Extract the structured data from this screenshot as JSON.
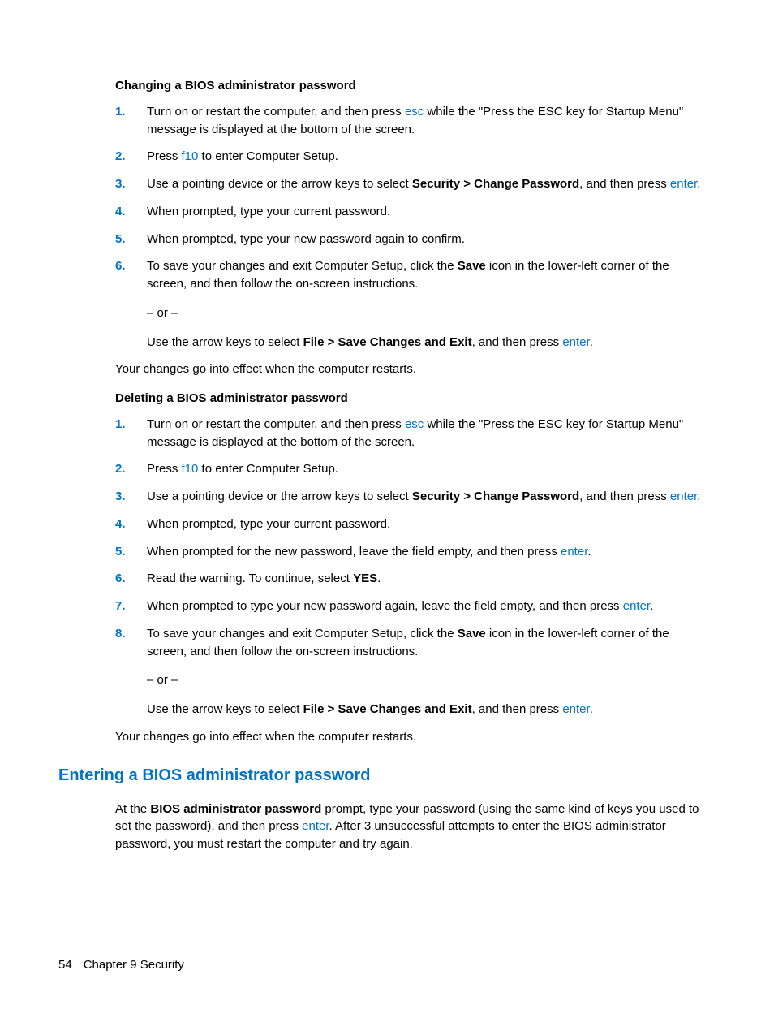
{
  "section1": {
    "heading": "Changing a BIOS administrator password",
    "step1a": "Turn on or restart the computer, and then press ",
    "step1k": "esc",
    "step1b": " while the \"Press the ESC key for Startup Menu\" message is displayed at the bottom of the screen.",
    "step2a": "Press ",
    "step2k": "f10",
    "step2b": " to enter Computer Setup.",
    "step3a": "Use a pointing device or the arrow keys to select ",
    "step3b": "Security > Change Password",
    "step3c": ", and then press ",
    "step3k": "enter",
    "step3d": ".",
    "step4": "When prompted, type your current password.",
    "step5": "When prompted, type your new password again to confirm.",
    "step6a": "To save your changes and exit Computer Setup, click the ",
    "step6b": "Save",
    "step6c": " icon in the lower-left corner of the screen, and then follow the on-screen instructions.",
    "or": "– or –",
    "alt_a": "Use the arrow keys to select ",
    "alt_b": "File > Save Changes and Exit",
    "alt_c": ", and then press ",
    "alt_k": "enter",
    "alt_d": ".",
    "after": "Your changes go into effect when the computer restarts."
  },
  "section2": {
    "heading": "Deleting a BIOS administrator password",
    "step1a": "Turn on or restart the computer, and then press ",
    "step1k": "esc",
    "step1b": " while the \"Press the ESC key for Startup Menu\" message is displayed at the bottom of the screen.",
    "step2a": "Press ",
    "step2k": "f10",
    "step2b": " to enter Computer Setup.",
    "step3a": "Use a pointing device or the arrow keys to select ",
    "step3b": "Security > Change Password",
    "step3c": ", and then press ",
    "step3k": "enter",
    "step3d": ".",
    "step4": "When prompted, type your current password.",
    "step5a": "When prompted for the new password, leave the field empty, and then press ",
    "step5k": "enter",
    "step5b": ".",
    "step6a": "Read the warning. To continue, select ",
    "step6b": "YES",
    "step6c": ".",
    "step7a": "When prompted to type your new password again, leave the field empty, and then press ",
    "step7k": "enter",
    "step7b": ".",
    "step8a": "To save your changes and exit Computer Setup, click the ",
    "step8b": "Save",
    "step8c": " icon in the lower-left corner of the screen, and then follow the on-screen instructions.",
    "or": "– or –",
    "alt_a": "Use the arrow keys to select ",
    "alt_b": "File > Save Changes and Exit",
    "alt_c": ", and then press ",
    "alt_k": "enter",
    "alt_d": ".",
    "after": "Your changes go into effect when the computer restarts."
  },
  "section3": {
    "heading": "Entering a BIOS administrator password",
    "p_a": "At the ",
    "p_b": "BIOS administrator password",
    "p_c": " prompt, type your password (using the same kind of keys you used to set the password), and then press ",
    "p_k": "enter",
    "p_d": ". After 3 unsuccessful attempts to enter the BIOS administrator password, you must restart the computer and try again."
  },
  "footer": {
    "page": "54",
    "chapter": "Chapter 9   Security"
  }
}
